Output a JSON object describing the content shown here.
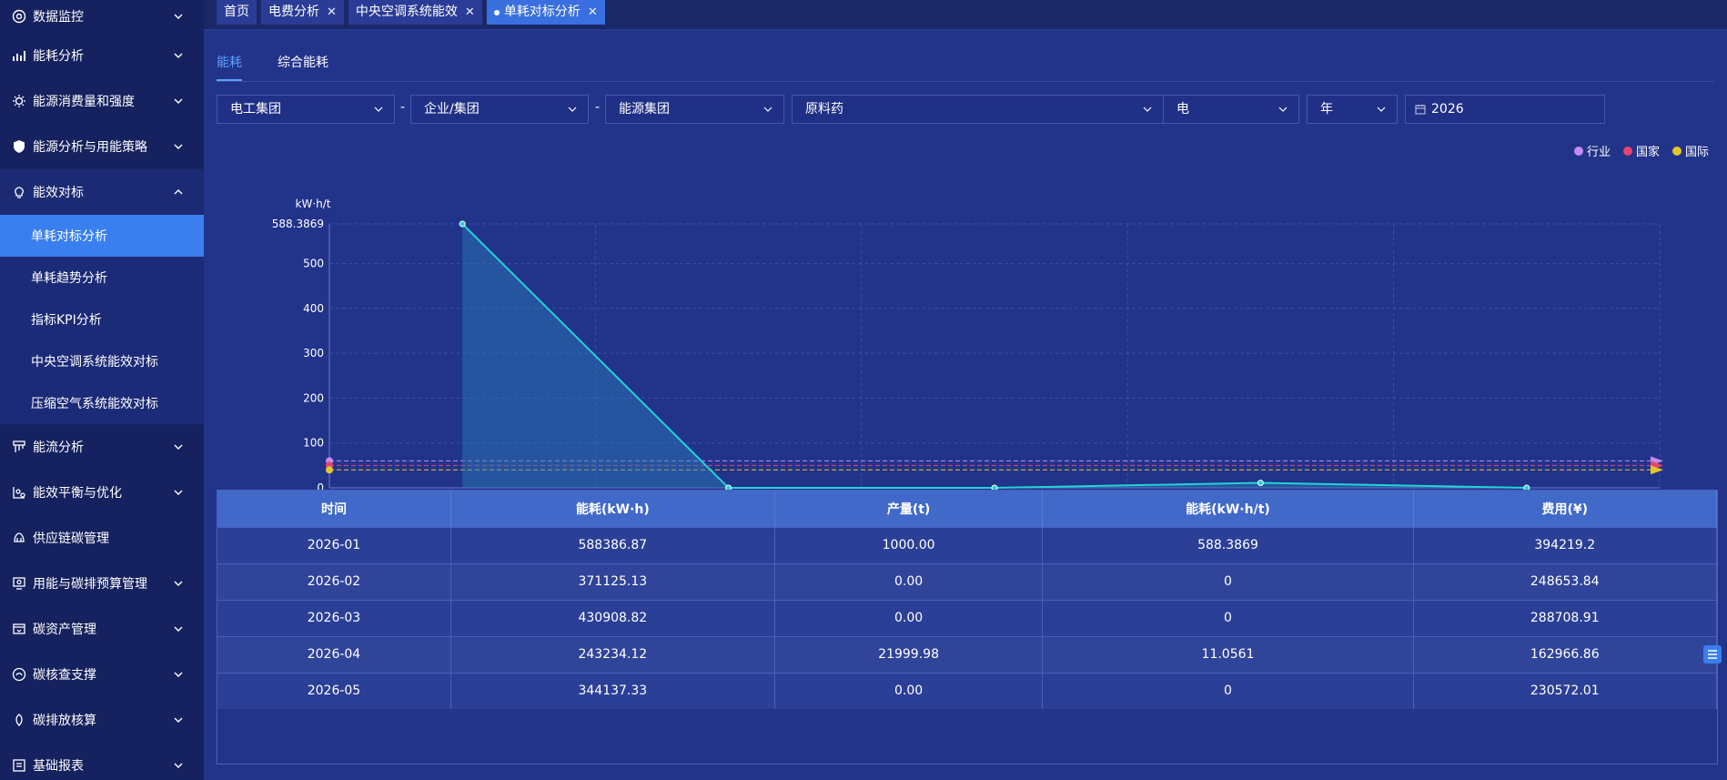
{
  "sidebar": {
    "items": [
      {
        "label": "数据监控",
        "icon": "monitor-icon",
        "expanded": false
      },
      {
        "label": "能耗分析",
        "icon": "bar-chart-icon",
        "expanded": false
      },
      {
        "label": "能源消费量和强度",
        "icon": "sun-icon",
        "expanded": false
      },
      {
        "label": "能源分析与用能策略",
        "icon": "shield-icon",
        "expanded": false
      },
      {
        "label": "能效对标",
        "icon": "bulb-icon",
        "expanded": true,
        "children": [
          "单耗对标分析",
          "单耗趋势分析",
          "指标KPI分析",
          "中央空调系统能效对标",
          "压缩空气系统能效对标"
        ]
      },
      {
        "label": "能流分析",
        "icon": "flow-icon",
        "expanded": false
      },
      {
        "label": "能效平衡与优化",
        "icon": "balance-icon",
        "expanded": false
      },
      {
        "label": "供应链碳管理",
        "icon": "supply-chain-icon",
        "expanded": false
      },
      {
        "label": "用能与碳排预算管理",
        "icon": "budget-icon",
        "expanded": false
      },
      {
        "label": "碳资产管理",
        "icon": "asset-icon",
        "expanded": false
      },
      {
        "label": "碳核查支撑",
        "icon": "verify-icon",
        "expanded": false
      },
      {
        "label": "碳排放核算",
        "icon": "carbon-icon",
        "expanded": false
      },
      {
        "label": "基础报表",
        "icon": "report-icon",
        "expanded": false
      }
    ],
    "active_child": "单耗对标分析"
  },
  "tabs": [
    {
      "label": "首页",
      "closable": false,
      "active": false
    },
    {
      "label": "电费分析",
      "closable": true,
      "active": false
    },
    {
      "label": "中央空调系统能效",
      "closable": true,
      "active": false
    },
    {
      "label": "单耗对标分析",
      "closable": true,
      "active": true
    }
  ],
  "subtabs": [
    {
      "label": "能耗",
      "active": true
    },
    {
      "label": "综合能耗",
      "active": false
    }
  ],
  "filters": {
    "group": "电工集团",
    "org": "企业/集团",
    "energy_group": "能源集团",
    "material": "原料药",
    "energy_type": "电",
    "period": "年",
    "date": "2026",
    "separator": "-"
  },
  "legend": [
    {
      "label": "行业",
      "color": "#c58bf2"
    },
    {
      "label": "国家",
      "color": "#e8446a"
    },
    {
      "label": "国际",
      "color": "#e3c72a"
    }
  ],
  "chart_data": {
    "type": "line",
    "ylabel": "kW·h/t",
    "ylim": [
      0,
      588.3869
    ],
    "yticks": [
      "0",
      "100",
      "200",
      "300",
      "400",
      "500",
      "588.3869"
    ],
    "yticks_values": [
      0,
      100,
      200,
      300,
      400,
      500,
      588.3869
    ],
    "categories": [
      "2026-01",
      "2026-02",
      "2026-03",
      "2026-04",
      "2026-05"
    ],
    "series": [
      {
        "values": [
          588.3869,
          0,
          0,
          11.0561,
          0
        ],
        "color": "#22d3d6"
      }
    ],
    "reference_lines": [
      {
        "name": "行业",
        "value": 60,
        "color": "#c58bf2"
      },
      {
        "name": "国家",
        "value": 50,
        "color": "#e8446a"
      },
      {
        "name": "国际",
        "value": 40,
        "color": "#e3c72a"
      }
    ],
    "grid": true
  },
  "table": {
    "columns": [
      "时间",
      "能耗(kW·h)",
      "产量(t)",
      "能耗(kW·h/t)",
      "费用(¥)"
    ],
    "rows": [
      [
        "2026-01",
        "588386.87",
        "1000.00",
        "588.3869",
        "394219.2"
      ],
      [
        "2026-02",
        "371125.13",
        "0.00",
        "0",
        "248653.84"
      ],
      [
        "2026-03",
        "430908.82",
        "0.00",
        "0",
        "288708.91"
      ],
      [
        "2026-04",
        "243234.12",
        "21999.98",
        "11.0561",
        "162966.86"
      ],
      [
        "2026-05",
        "344137.33",
        "0.00",
        "0",
        "230572.01"
      ]
    ]
  }
}
